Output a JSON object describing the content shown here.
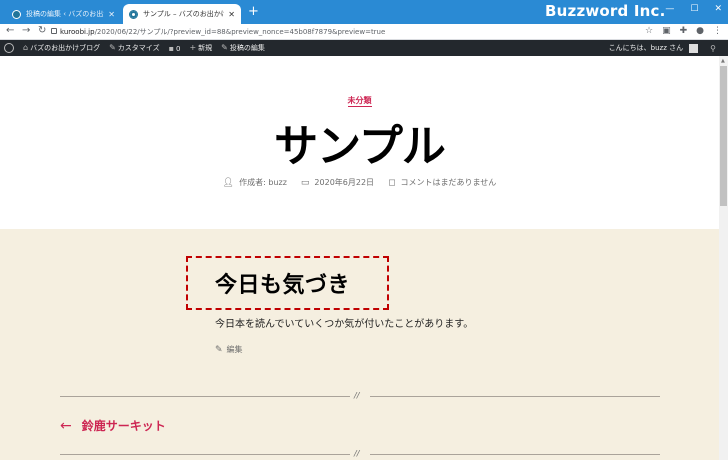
{
  "browser": {
    "tabs": [
      {
        "label": "投稿の編集 ‹ バズのお出かけブログ —",
        "active": false
      },
      {
        "label": "サンプル – バズのお出かけブログ",
        "active": true
      }
    ],
    "new_tab": "+",
    "brand": "Buzzword Inc.",
    "url_host": "kuroobi.jp",
    "url_path": "/2020/06/22/サンプル/?preview_id=88&preview_nonce=45b08f7879&preview=true"
  },
  "adminbar": {
    "site_name": "バズのお出かけブログ",
    "customize": "カスタマイズ",
    "comments_count": "0",
    "new": "新規",
    "edit_post": "投稿の編集",
    "greeting": "こんにちは、buzz さん"
  },
  "post": {
    "category": "未分類",
    "title": "サンプル",
    "author": "作成者: buzz",
    "date": "2020年6月22日",
    "comments": "コメントはまだありません",
    "heading": "今日も気づき",
    "paragraph": "今日本を読んでいていくつか気が付いたことがあります。",
    "edit": "編集",
    "separator": "//",
    "prev_arrow": "←",
    "prev_title": "鈴鹿サーキット"
  },
  "colors": {
    "titlebar": "#2a8ad4",
    "adminbar": "#23282d",
    "accent": "#cd2653",
    "content_bg": "#f5efe0",
    "highlight_border": "#c00000"
  }
}
